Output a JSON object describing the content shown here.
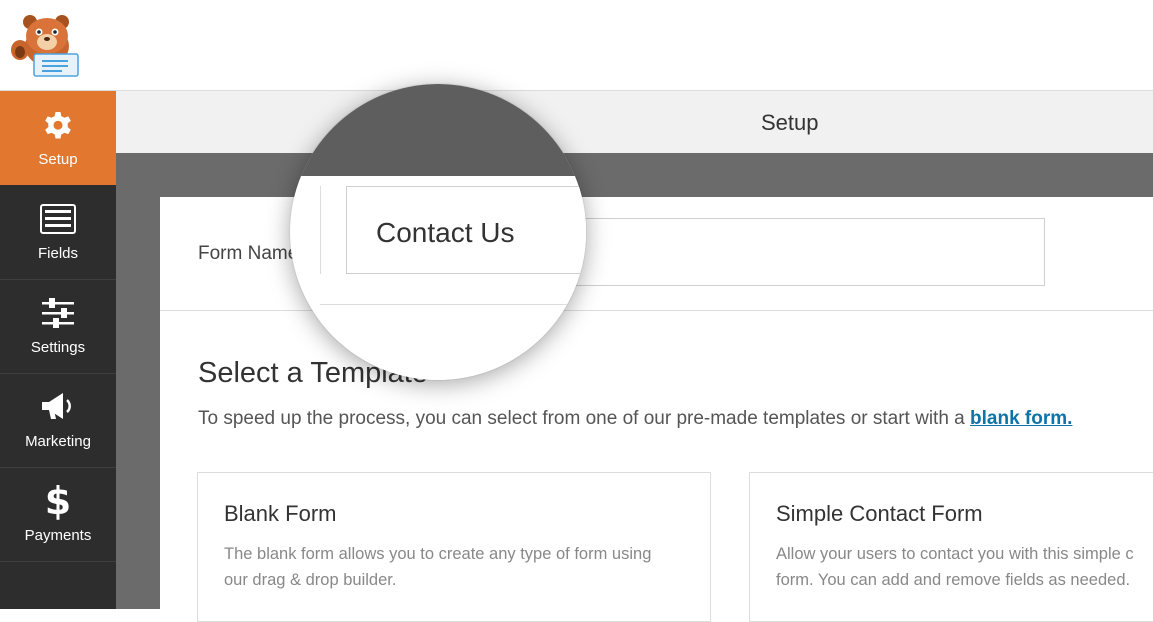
{
  "sidebar": {
    "items": [
      {
        "label": "Setup",
        "icon": "gear-icon",
        "active": true
      },
      {
        "label": "Fields",
        "icon": "list-icon",
        "active": false
      },
      {
        "label": "Settings",
        "icon": "sliders-icon",
        "active": false
      },
      {
        "label": "Marketing",
        "icon": "megaphone-icon",
        "active": false
      },
      {
        "label": "Payments",
        "icon": "dollar-icon",
        "active": false
      }
    ]
  },
  "header": {
    "title": "Setup"
  },
  "form": {
    "name_label": "Form Name",
    "name_value": "Contact Us"
  },
  "templates": {
    "title": "Select a Template",
    "description": "To speed up the process, you can select from one of our pre-made templates or start with a ",
    "blank_link": "blank form.",
    "cards": [
      {
        "name": "Blank Form",
        "text": "The blank form allows you to create any type of form using\nour drag & drop builder."
      },
      {
        "name": "Simple Contact Form",
        "text": "Allow your users to contact you with this simple c\nform. You can add and remove fields as needed."
      }
    ]
  },
  "colors": {
    "accent": "#e27730",
    "sidebar_bg": "#2d2d2d",
    "link": "#0e74a8"
  }
}
